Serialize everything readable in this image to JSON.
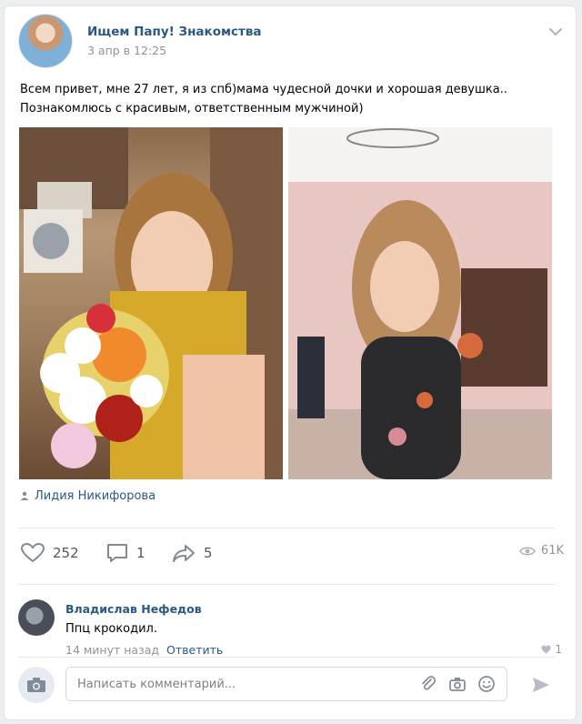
{
  "post": {
    "group_name": "Ищем Папу! Знакомства",
    "date": "3 апр в 12:25",
    "text_lines": [
      "Всем привет, мне 27 лет, я из спб)мама чудесной дочки и хорошая девушка..",
      "Познакомлюсь с красивым, ответственным мужчиной)"
    ],
    "author_signature": "Лидия Никифорова",
    "photos": [
      {
        "alt": "photo-with-flowers"
      },
      {
        "alt": "photo-in-pink-room"
      }
    ]
  },
  "actions": {
    "likes": "252",
    "comments": "1",
    "shares": "5",
    "views": "61K"
  },
  "comment": {
    "author": "Владислав Нефедов",
    "text": "Ппц крокодил.",
    "time": "14 минут назад",
    "reply_label": "Ответить",
    "likes": "1"
  },
  "comment_input": {
    "placeholder": "Написать комментарий..."
  },
  "colors": {
    "link": "#2a5885",
    "muted": "#939393",
    "icon": "#828a99",
    "background": "#edeef0"
  },
  "icons": [
    "chevron-down-icon",
    "user-icon",
    "heart-icon",
    "comment-icon",
    "share-icon",
    "eye-icon",
    "camera-icon",
    "paperclip-icon",
    "smile-icon",
    "send-icon"
  ]
}
